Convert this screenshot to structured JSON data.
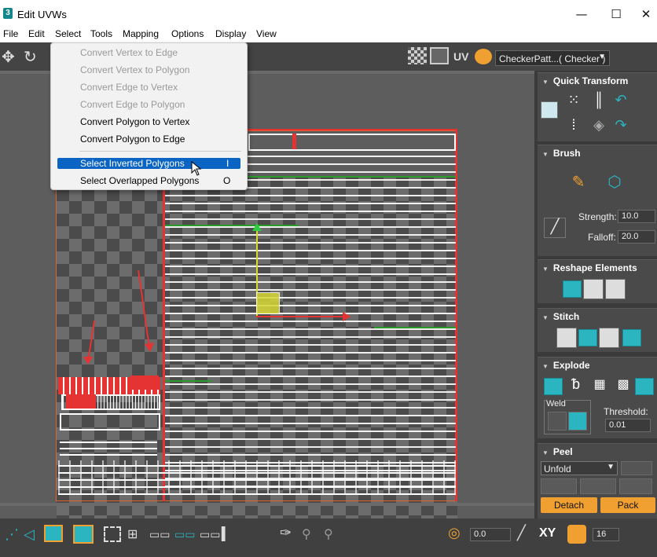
{
  "window": {
    "title": "Edit UVWs",
    "icon_text": "3",
    "minimize_icon": "minimize-icon",
    "maximize_icon": "maximize-icon",
    "close_icon": "close-icon"
  },
  "menu": [
    "File",
    "Edit",
    "Select",
    "Tools",
    "Mapping",
    "Options",
    "Display",
    "View"
  ],
  "toolbar": {
    "uv_label": "UV",
    "texture_dropdown": "CheckerPatt...( Checker )"
  },
  "select_menu": {
    "items": [
      {
        "label": "Convert Vertex to Edge",
        "enabled": false,
        "shortcut": ""
      },
      {
        "label": "Convert Vertex to Polygon",
        "enabled": false,
        "shortcut": ""
      },
      {
        "label": "Convert Edge to Vertex",
        "enabled": false,
        "shortcut": ""
      },
      {
        "label": "Convert Edge to Polygon",
        "enabled": false,
        "shortcut": ""
      },
      {
        "label": "Convert Polygon to Vertex",
        "enabled": true,
        "shortcut": ""
      },
      {
        "label": "Convert Polygon to Edge",
        "enabled": true,
        "shortcut": ""
      },
      {
        "label": "Select Inverted Polygons",
        "enabled": true,
        "shortcut": "I",
        "highlighted": true
      },
      {
        "label": "Select Overlapped Polygons",
        "enabled": true,
        "shortcut": "O"
      }
    ]
  },
  "panel": {
    "quick_transform": "Quick Transform",
    "brush": "Brush",
    "strength_label": "Strength:",
    "strength_value": "10.0",
    "falloff_label": "Falloff:",
    "falloff_value": "20.0",
    "reshape": "Reshape Elements",
    "stitch": "Stitch",
    "explode": "Explode",
    "weld": "Weld",
    "threshold_label": "Threshold:",
    "threshold_value": "0.01",
    "peel": "Peel",
    "unfold_dropdown": "Unfold",
    "detach": "Detach",
    "pack": "Pack"
  },
  "statusbar": {
    "coord_value": "0.0",
    "axis_label": "XY",
    "grid_value": "16"
  },
  "colors": {
    "accent_orange": "#f0a030",
    "highlight_blue": "#0a64c4",
    "teal_icon": "#2ab5c0",
    "uv_red": "#e53232",
    "gizmo_green": "#2ecc40",
    "gizmo_yellow": "#d7d735"
  }
}
